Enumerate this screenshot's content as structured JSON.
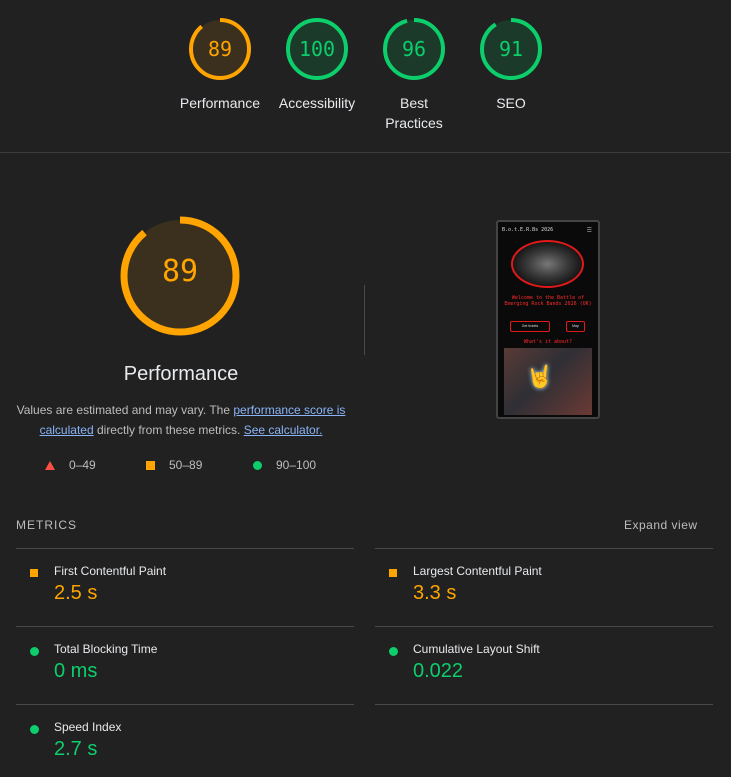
{
  "colors": {
    "pass": "#0cce6b",
    "average": "#ffa400",
    "fail": "#ff4e42"
  },
  "summary": [
    {
      "name": "Performance",
      "score": "89",
      "value": 89,
      "status": "average"
    },
    {
      "name": "Accessibility",
      "score": "100",
      "value": 100,
      "status": "pass"
    },
    {
      "name": "Best\nPractices",
      "score": "96",
      "value": 96,
      "status": "pass"
    },
    {
      "name": "SEO",
      "score": "91",
      "value": 91,
      "status": "pass"
    }
  ],
  "performance": {
    "score": "89",
    "value": 89,
    "title": "Performance",
    "desc_prefix": "Values are estimated and may vary. The ",
    "link1": "performance score is calculated",
    "desc_mid": " directly from these metrics. ",
    "link2": "See calculator."
  },
  "legend": [
    {
      "shape": "triangle",
      "label": "0–49"
    },
    {
      "shape": "square",
      "label": "50–89"
    },
    {
      "shape": "circle",
      "label": "90–100"
    }
  ],
  "screenshot": {
    "site_title": "B.o.t.E.R.Bs 2026",
    "menu_icon": "hamburger-icon",
    "welcome": "Welcome to the Battle of Emerging Rock Bands 2026 (UK)",
    "button1": "Get tickets",
    "button2": "Map",
    "what": "What's it about?",
    "neon_icon": "rock-hand-icon"
  },
  "metrics_title": "METRICS",
  "expand_label": "Expand view",
  "metrics": [
    {
      "name": "First Contentful Paint",
      "value": "2.5 s",
      "status": "average"
    },
    {
      "name": "Largest Contentful Paint",
      "value": "3.3 s",
      "status": "average"
    },
    {
      "name": "Total Blocking Time",
      "value": "0 ms",
      "status": "pass"
    },
    {
      "name": "Cumulative Layout Shift",
      "value": "0.022",
      "status": "pass"
    },
    {
      "name": "Speed Index",
      "value": "2.7 s",
      "status": "pass"
    }
  ]
}
